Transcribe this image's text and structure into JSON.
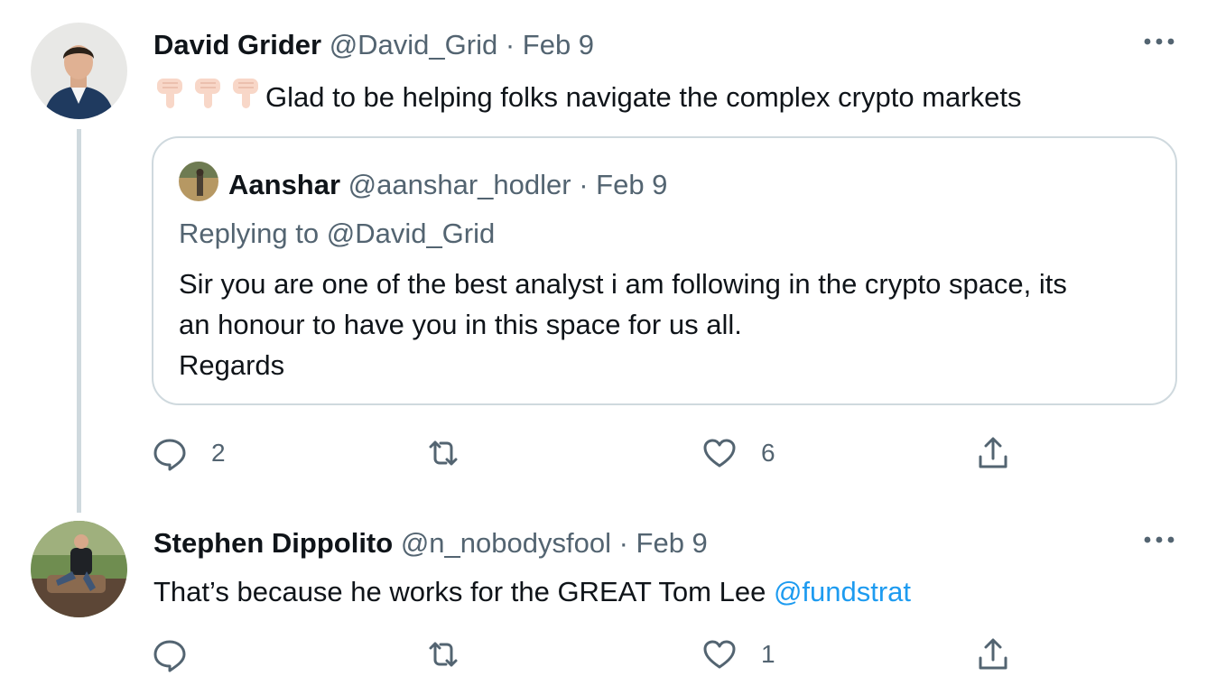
{
  "tweets": [
    {
      "author_name": "David Grider",
      "handle": "@David_Grid",
      "separator": " · ",
      "date": "Feb 9",
      "text": "Glad to be helping folks navigate the complex crypto markets",
      "leading_emoji": [
        "backhand-index-pointing-down",
        "backhand-index-pointing-down",
        "backhand-index-pointing-down"
      ],
      "quote": {
        "author_name": "Aanshar",
        "handle": "@aanshar_hodler",
        "separator": " · ",
        "date": "Feb 9",
        "replying_prefix": "Replying to ",
        "replying_to": "@David_Grid",
        "lines": [
          "Sir you are one of the best analyst i am following in the crypto space,  its",
          "an honour to have you in this space for us all.",
          "Regards"
        ]
      },
      "actions": {
        "reply_count": "2",
        "retweet_count": "",
        "like_count": "6"
      }
    },
    {
      "author_name": "Stephen Dippolito",
      "handle": "@n_nobodysfool",
      "separator": " · ",
      "date": "Feb 9",
      "text": "That’s because he works for the GREAT Tom Lee ",
      "mention": "@fundstrat",
      "actions": {
        "reply_count": "",
        "retweet_count": "",
        "like_count": "1"
      }
    }
  ],
  "icons": {
    "more": "more-horizontal-icon",
    "reply": "reply-icon",
    "retweet": "retweet-icon",
    "like": "heart-icon",
    "share": "share-icon"
  },
  "colors": {
    "text": "#0f1419",
    "secondary": "#536471",
    "link": "#1d9bf0",
    "border": "#cfd9de"
  }
}
